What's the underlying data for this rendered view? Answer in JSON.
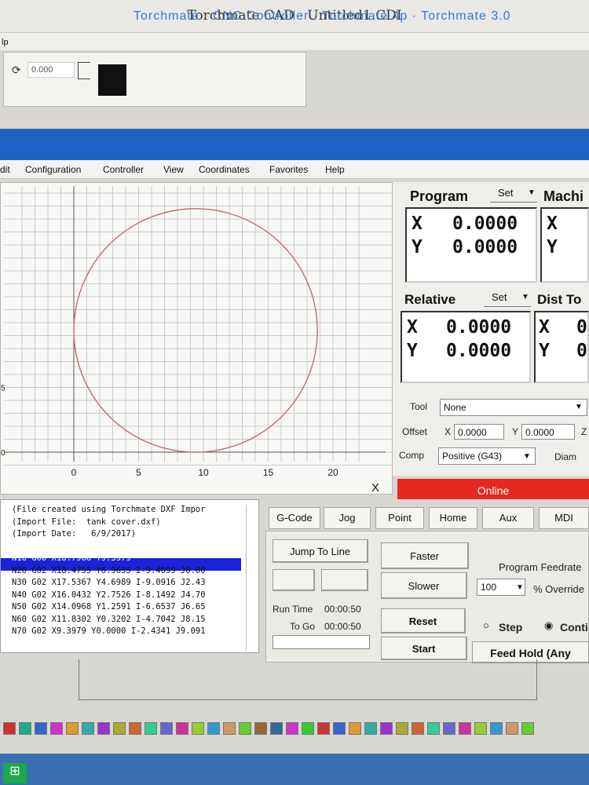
{
  "cad": {
    "title": "Torchmate CAD - Untitled1.CDI",
    "menu_fragment": "lp",
    "rotate_value": "0.000"
  },
  "cnc": {
    "title": "Torchmate · CNC Controller · Torchmate 4p · Torchmate 3.0",
    "menu": [
      "dit",
      "Configuration",
      "Controller",
      "View",
      "Coordinates",
      "Favorites",
      "Help"
    ]
  },
  "plot": {
    "x_ticks": [
      "0",
      "5",
      "10",
      "15",
      "20"
    ],
    "y_ticks": [
      "0",
      "5",
      "0"
    ],
    "x_axis_label": "X"
  },
  "program_panel": {
    "label": "Program",
    "set": "Set",
    "x_label": "X",
    "y_label": "Y",
    "x": "0.0000",
    "y": "0.0000"
  },
  "machine_panel": {
    "label": "Machi",
    "x_label": "X",
    "y_label": "Y"
  },
  "relative_panel": {
    "label": "Relative",
    "set": "Set",
    "x_label": "X",
    "y_label": "Y",
    "x": "0.0000",
    "y": "0.0000"
  },
  "dist_panel": {
    "label": "Dist To",
    "x_label": "X",
    "y_label": "Y",
    "x": "0",
    "y": "0"
  },
  "tool": {
    "tool_label": "Tool",
    "tool_value": "None",
    "offset_label": "Offset",
    "offset_x_label": "X",
    "offset_x": "0.0000",
    "offset_y_label": "Y",
    "offset_y": "0.0000",
    "offset_z_label": "Z",
    "comp_label": "Comp",
    "comp_value": "Positive (G43)",
    "diam_label": "Diam"
  },
  "status": {
    "online": "Online"
  },
  "gcode_lines": [
    "(File created using Torchmate DXF Impor",
    "(Import File:  tank cover.dxf)",
    "(Import Date:   6/9/2017)",
    "",
    "N10 G00 X18.7968 Y9.3979",
    "N20 G02 X18.4755 Y6.9655 I-9.4099 J0.00",
    "N30 G02 X17.5367 Y4.6989 I-9.0916 J2.43",
    "N40 G02 X16.0432 Y2.7526 I-8.1492 J4.70",
    "N50 G02 X14.0968 Y1.2591 I-6.6537 J6.65",
    "N60 G02 X11.8302 Y0.3202 I-4.7042 J8.15",
    "N70 G02 X9.3979 Y0.0000 I-2.4341 J9.091"
  ],
  "tabs": [
    "G-Code",
    "Jog",
    "Point",
    "Home",
    "Aux",
    "MDI"
  ],
  "controls": {
    "jump_to_line": "Jump To Line",
    "faster": "Faster",
    "slower": "Slower",
    "program_feedrate": "Program Feedrate",
    "feed_override_value": "100",
    "override_label": "% Override",
    "run_time_label": "Run Time",
    "run_time": "00:00:50",
    "to_go_label": "To Go",
    "to_go": "00:00:50",
    "reset": "Reset",
    "start": "Start",
    "step": "Step",
    "continuous": "Conti",
    "feed_hold": "Feed Hold (Any"
  },
  "colors": {
    "titlebar": "#1e63c4",
    "online": "#e52920",
    "selected_line": "#1a23d6",
    "circle": "#c46b6b"
  },
  "chart_data": {
    "type": "line",
    "title": "",
    "xlabel": "X",
    "ylabel": "",
    "xlim": [
      -4,
      22
    ],
    "ylim": [
      -1,
      20
    ],
    "series": [
      {
        "shape": "circle",
        "center": [
          9.3979,
          9.3979
        ],
        "radius": 9.3979
      }
    ]
  }
}
